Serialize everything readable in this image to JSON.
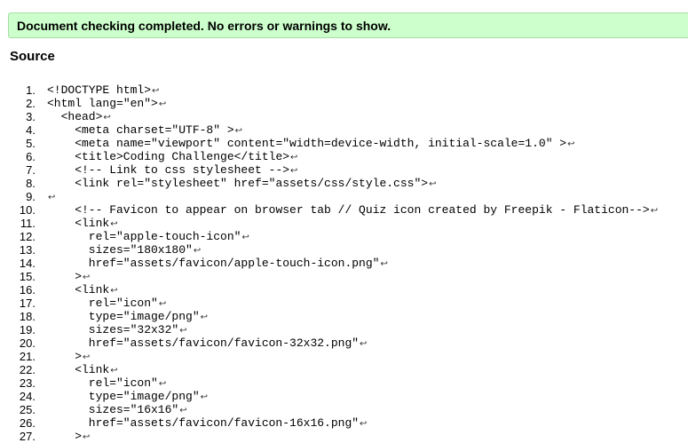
{
  "banner": {
    "message": "Document checking completed. No errors or warnings to show."
  },
  "source": {
    "heading": "Source",
    "newline_icon": "return-arrow-icon",
    "newline_glyph": "↩",
    "lines": [
      {
        "number": "1.",
        "indent": 0,
        "text": "<!DOCTYPE html>"
      },
      {
        "number": "2.",
        "indent": 0,
        "text": "<html lang=\"en\">"
      },
      {
        "number": "3.",
        "indent": 2,
        "text": "<head>"
      },
      {
        "number": "4.",
        "indent": 4,
        "text": "<meta charset=\"UTF-8\" >"
      },
      {
        "number": "5.",
        "indent": 4,
        "text": "<meta name=\"viewport\" content=\"width=device-width, initial-scale=1.0\" >"
      },
      {
        "number": "6.",
        "indent": 4,
        "text": "<title>Coding Challenge</title>"
      },
      {
        "number": "7.",
        "indent": 4,
        "text": "<!-- Link to css stylesheet -->"
      },
      {
        "number": "8.",
        "indent": 4,
        "text": "<link rel=\"stylesheet\" href=\"assets/css/style.css\">"
      },
      {
        "number": "9.",
        "indent": 0,
        "text": ""
      },
      {
        "number": "10.",
        "indent": 4,
        "text": "<!-- Favicon to appear on browser tab // Quiz icon created by Freepik - Flaticon-->"
      },
      {
        "number": "11.",
        "indent": 4,
        "text": "<link"
      },
      {
        "number": "12.",
        "indent": 6,
        "text": "rel=\"apple-touch-icon\""
      },
      {
        "number": "13.",
        "indent": 6,
        "text": "sizes=\"180x180\""
      },
      {
        "number": "14.",
        "indent": 6,
        "text": "href=\"assets/favicon/apple-touch-icon.png\""
      },
      {
        "number": "15.",
        "indent": 4,
        "text": ">"
      },
      {
        "number": "16.",
        "indent": 4,
        "text": "<link"
      },
      {
        "number": "17.",
        "indent": 6,
        "text": "rel=\"icon\""
      },
      {
        "number": "18.",
        "indent": 6,
        "text": "type=\"image/png\""
      },
      {
        "number": "19.",
        "indent": 6,
        "text": "sizes=\"32x32\""
      },
      {
        "number": "20.",
        "indent": 6,
        "text": "href=\"assets/favicon/favicon-32x32.png\""
      },
      {
        "number": "21.",
        "indent": 4,
        "text": ">"
      },
      {
        "number": "22.",
        "indent": 4,
        "text": "<link"
      },
      {
        "number": "23.",
        "indent": 6,
        "text": "rel=\"icon\""
      },
      {
        "number": "24.",
        "indent": 6,
        "text": "type=\"image/png\""
      },
      {
        "number": "25.",
        "indent": 6,
        "text": "sizes=\"16x16\""
      },
      {
        "number": "26.",
        "indent": 6,
        "text": "href=\"assets/favicon/favicon-16x16.png\""
      },
      {
        "number": "27.",
        "indent": 4,
        "text": ">"
      }
    ]
  }
}
